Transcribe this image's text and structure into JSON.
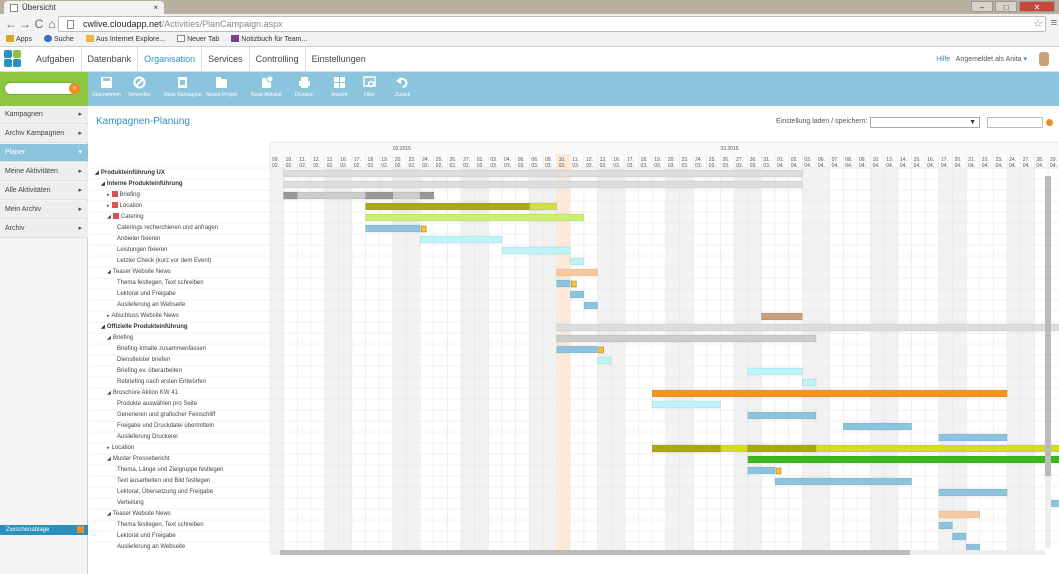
{
  "browser": {
    "tab_title": "Übersicht",
    "tab_close": "×",
    "url_host": "cwlive.cloudapp.net",
    "url_path": "/Activities/PlanCampaign.aspx",
    "nav_back": "←",
    "nav_forward": "→",
    "nav_reload": "C",
    "nav_home": "⌂",
    "star": "☆",
    "menu": "≡",
    "window_min": "–",
    "window_max": "□",
    "window_close": "✕",
    "bookmarks": [
      "Apps",
      "Suche",
      "Aus Internet Explore...",
      "Neuer Tab",
      "Notizbuch für Team..."
    ]
  },
  "app": {
    "nav": [
      "Aufgaben",
      "Datenbank",
      "Organisation",
      "Services",
      "Controlling",
      "Einstellungen"
    ],
    "active_nav": "Organisation",
    "help": "Hilfe",
    "user": "Angemeldet als Anita",
    "user_caret": "▾",
    "accent": "#2b8fbf",
    "green": "#8cc63f",
    "toolbar_color": "#8cc4dd"
  },
  "sidebar": {
    "search_go": "»",
    "items": [
      {
        "label": "Kampagnen",
        "arrow": "▸"
      },
      {
        "label": "Archiv Kampagnen",
        "arrow": "▸"
      },
      {
        "label": "Planer",
        "arrow": "▾"
      },
      {
        "label": "Meine Aktivitäten",
        "arrow": "▸"
      },
      {
        "label": "Alle Aktivitäten",
        "arrow": "▸"
      },
      {
        "label": "Mein Archiv",
        "arrow": "▸"
      },
      {
        "label": "Archiv",
        "arrow": "▸"
      }
    ],
    "active": "Planer",
    "notes_label": "Zwischenablage"
  },
  "toolbar": {
    "buttons": [
      {
        "label": "Übernehmen",
        "icon": "save-icon"
      },
      {
        "label": "Verwerfen",
        "icon": "cancel-icon"
      },
      {
        "label": "Neue Kampagne",
        "icon": "new-campaign-icon"
      },
      {
        "label": "Neues Projekt",
        "icon": "new-project-icon"
      },
      {
        "label": "Neue Aktivität",
        "icon": "new-activity-icon"
      },
      {
        "label": "Drucken",
        "icon": "print-icon"
      },
      {
        "label": "Ansicht",
        "icon": "view-icon"
      },
      {
        "label": "Filter",
        "icon": "filter-icon"
      },
      {
        "label": "Zurück",
        "icon": "undo-icon"
      }
    ]
  },
  "page": {
    "title": "Kampagnen-Planung",
    "settings_label": "Einstellung laden / speichern:",
    "settings_select_caret": "▼"
  },
  "timeline": {
    "months": [
      "02.2015",
      "03.2015"
    ],
    "days": [
      "09.",
      "10.",
      "11.",
      "12.",
      "13.",
      "16.",
      "17.",
      "18.",
      "19.",
      "20.",
      "23.",
      "24.",
      "25.",
      "26.",
      "27.",
      "02.",
      "03.",
      "04.",
      "05.",
      "06.",
      "09.",
      "10.",
      "11.",
      "12.",
      "13.",
      "16.",
      "17.",
      "18.",
      "19.",
      "20.",
      "23.",
      "24.",
      "25.",
      "26.",
      "27.",
      "30.",
      "31.",
      "01.",
      "02.",
      "03.",
      "06.",
      "07.",
      "08.",
      "09.",
      "10.",
      "13.",
      "14.",
      "15.",
      "16.",
      "17.",
      "20.",
      "21.",
      "22.",
      "23.",
      "24.",
      "27.",
      "28.",
      "29.",
      "30.",
      "01.",
      "02.",
      "03.",
      "04.",
      "05."
    ],
    "monthnums": [
      "02.",
      "02.",
      "02.",
      "02.",
      "02.",
      "02.",
      "02.",
      "02.",
      "02.",
      "02.",
      "02.",
      "02.",
      "02.",
      "02.",
      "02.",
      "03.",
      "03.",
      "03.",
      "03.",
      "03.",
      "03.",
      "03.",
      "03.",
      "03.",
      "03.",
      "03.",
      "03.",
      "03.",
      "03.",
      "03.",
      "03.",
      "03.",
      "03.",
      "03.",
      "03.",
      "03.",
      "03.",
      "04.",
      "04.",
      "04.",
      "04.",
      "04.",
      "04.",
      "04.",
      "04.",
      "04.",
      "04.",
      "04.",
      "04.",
      "04.",
      "04.",
      "04.",
      "04.",
      "04.",
      "04.",
      "04.",
      "04.",
      "04.",
      "04.",
      "05.",
      "05.",
      "05.",
      "05.",
      "05."
    ],
    "today_index": 21
  },
  "tasks": [
    {
      "label": "Produkteinführung UX",
      "level": 0,
      "bold": true,
      "tri": "◢"
    },
    {
      "label": "Interne Produkteinführung",
      "level": 1,
      "bold": true,
      "tri": "◢"
    },
    {
      "label": "Briefing",
      "level": 2,
      "tri": "▸",
      "icon": true
    },
    {
      "label": "Location",
      "level": 2,
      "tri": "▸",
      "icon": true
    },
    {
      "label": "Catering",
      "level": 2,
      "tri": "◢",
      "icon": true
    },
    {
      "label": "Caterings recherchieren und anfragen",
      "level": 3
    },
    {
      "label": "Anbieter fixieren",
      "level": 3
    },
    {
      "label": "Leistungen fixieren",
      "level": 3
    },
    {
      "label": "Letzter Check (kurz vor dem Event)",
      "level": 3
    },
    {
      "label": "Teaser Website News",
      "level": 2,
      "tri": "◢"
    },
    {
      "label": "Thema festlegen, Text schreiben",
      "level": 3
    },
    {
      "label": "Lektorat und Freigabe",
      "level": 3
    },
    {
      "label": "Auslieferung an Webseite",
      "level": 3
    },
    {
      "label": "Abschluss Website News",
      "level": 2,
      "tri": "▸"
    },
    {
      "label": "Offizielle Produkteinführung",
      "level": 1,
      "bold": true,
      "tri": "◢"
    },
    {
      "label": "Briefing",
      "level": 2,
      "tri": "◢"
    },
    {
      "label": "Briefing-Inhalte zusammenfassen",
      "level": 3
    },
    {
      "label": "Dienstleister briefen",
      "level": 3
    },
    {
      "label": "Briefing ev. überarbeiten",
      "level": 3
    },
    {
      "label": "Rebriefing nach ersten Entwürfen",
      "level": 3
    },
    {
      "label": "Broschüre Aktion KW 41",
      "level": 2,
      "tri": "◢"
    },
    {
      "label": "Produkte auswählen pro Seite",
      "level": 3
    },
    {
      "label": "Generieren und grafischer Feinschliff",
      "level": 3
    },
    {
      "label": "Freigabe und Druckdatei übermitteln",
      "level": 3
    },
    {
      "label": "Auslieferung Druckerei",
      "level": 3
    },
    {
      "label": "Location",
      "level": 2,
      "tri": "▸"
    },
    {
      "label": "Muster Pressebericht",
      "level": 2,
      "tri": "◢"
    },
    {
      "label": "Thema, Länge und Zielgruppe festlegen",
      "level": 3
    },
    {
      "label": "Text ausarbeiten und Bild festlegen",
      "level": 3
    },
    {
      "label": "Lektorat, Übersetzung und Freigabe",
      "level": 3
    },
    {
      "label": "Verteilung",
      "level": 3
    },
    {
      "label": "Teaser Website News",
      "level": 2,
      "tri": "◢"
    },
    {
      "label": "Thema festlegen, Text schreiben",
      "level": 3
    },
    {
      "label": "Lektorat und Freigabe",
      "level": 3
    },
    {
      "label": "Auslieferung an Webseite",
      "level": 3
    }
  ],
  "bars": [
    {
      "row": 0,
      "start": 1,
      "end": 39,
      "color": "#dddddd"
    },
    {
      "row": 1,
      "start": 1,
      "end": 39,
      "color": "#dddddd"
    },
    {
      "row": 2,
      "start": 1,
      "end": 12,
      "color": "#cccccc"
    },
    {
      "row": 2,
      "start": 1,
      "end": 2,
      "color": "#999999"
    },
    {
      "row": 2,
      "start": 7,
      "end": 9,
      "color": "#999999"
    },
    {
      "row": 2,
      "start": 11,
      "end": 12,
      "color": "#999999"
    },
    {
      "row": 3,
      "start": 7,
      "end": 20,
      "color": "#aaa818"
    },
    {
      "row": 3,
      "start": 19,
      "end": 21,
      "color": "#cfe046"
    },
    {
      "row": 4,
      "start": 7,
      "end": 23,
      "color": "#cdee6e"
    },
    {
      "row": 5,
      "start": 7,
      "end": 11,
      "color": "#8cc4dd"
    },
    {
      "row": 6,
      "start": 11,
      "end": 17,
      "color": "#bdf4f8"
    },
    {
      "row": 7,
      "start": 17,
      "end": 22,
      "color": "#bdf4f8"
    },
    {
      "row": 8,
      "start": 22,
      "end": 23,
      "color": "#bdf4f8"
    },
    {
      "row": 9,
      "start": 21,
      "end": 24,
      "color": "#f8c9a0"
    },
    {
      "row": 10,
      "start": 21,
      "end": 22,
      "color": "#8cc4dd"
    },
    {
      "row": 11,
      "start": 22,
      "end": 23,
      "color": "#8cc4dd"
    },
    {
      "row": 12,
      "start": 23,
      "end": 24,
      "color": "#8cc4dd"
    },
    {
      "row": 13,
      "start": 36,
      "end": 39,
      "color": "#c9a07a"
    },
    {
      "row": 14,
      "start": 21,
      "end": 60,
      "color": "#dddddd"
    },
    {
      "row": 15,
      "start": 21,
      "end": 40,
      "color": "#cccccc"
    },
    {
      "row": 16,
      "start": 21,
      "end": 24,
      "color": "#8cc4dd"
    },
    {
      "row": 17,
      "start": 24,
      "end": 25,
      "color": "#bdf4f8"
    },
    {
      "row": 18,
      "start": 35,
      "end": 39,
      "color": "#bdf4f8"
    },
    {
      "row": 19,
      "start": 39,
      "end": 40,
      "color": "#bdf4f8"
    },
    {
      "row": 20,
      "start": 28,
      "end": 54,
      "color": "#f7931e"
    },
    {
      "row": 21,
      "start": 28,
      "end": 33,
      "color": "#bdf4f8"
    },
    {
      "row": 22,
      "start": 35,
      "end": 40,
      "color": "#8cc4dd"
    },
    {
      "row": 23,
      "start": 42,
      "end": 47,
      "color": "#8cc4dd"
    },
    {
      "row": 24,
      "start": 49,
      "end": 54,
      "color": "#8cc4dd"
    },
    {
      "row": 25,
      "start": 28,
      "end": 60,
      "color": "#d4dc28"
    },
    {
      "row": 25,
      "start": 28,
      "end": 33,
      "color": "#aaa818"
    },
    {
      "row": 25,
      "start": 35,
      "end": 40,
      "color": "#aaa818"
    },
    {
      "row": 26,
      "start": 35,
      "end": 60,
      "color": "#3cb81e"
    },
    {
      "row": 27,
      "start": 35,
      "end": 37,
      "color": "#8cc4dd"
    },
    {
      "row": 28,
      "start": 37,
      "end": 47,
      "color": "#8cc4dd"
    },
    {
      "row": 29,
      "start": 49,
      "end": 54,
      "color": "#8cc4dd"
    },
    {
      "row": 30,
      "start": 57,
      "end": 58,
      "color": "#8cc4dd"
    },
    {
      "row": 31,
      "start": 49,
      "end": 52,
      "color": "#f8c9a0"
    },
    {
      "row": 32,
      "start": 49,
      "end": 50,
      "color": "#8cc4dd"
    },
    {
      "row": 33,
      "start": 50,
      "end": 51,
      "color": "#8cc4dd"
    },
    {
      "row": 34,
      "start": 51,
      "end": 52,
      "color": "#8cc4dd"
    }
  ],
  "milestones": [
    {
      "row": 5,
      "at": 11,
      "icon": "note-icon"
    },
    {
      "row": 10,
      "at": 22,
      "icon": "note-icon"
    },
    {
      "row": 16,
      "at": 24,
      "icon": "note-icon"
    },
    {
      "row": 27,
      "at": 37,
      "icon": "note-icon"
    }
  ]
}
